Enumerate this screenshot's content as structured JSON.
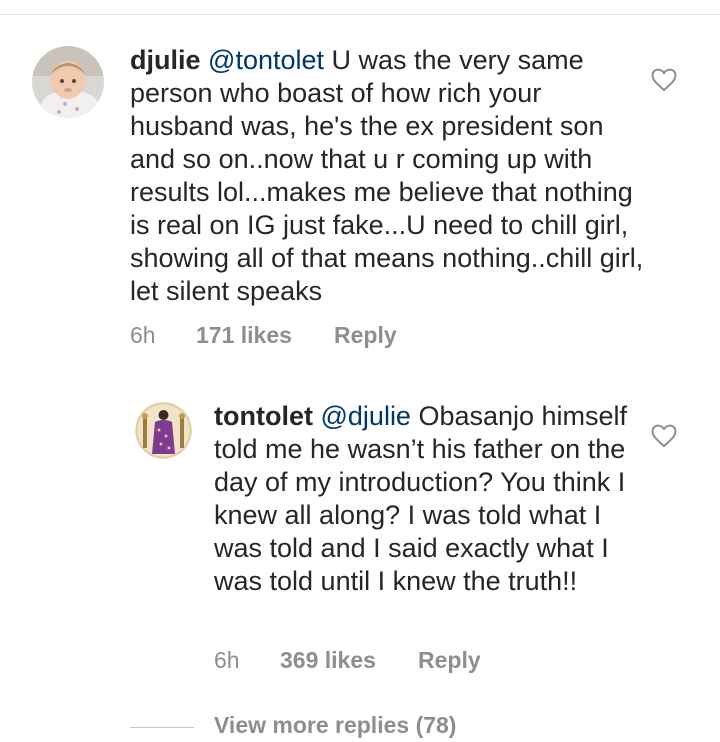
{
  "comments": [
    {
      "username": "djulie",
      "mention": "@tontolet",
      "body": " U was the very same person who boast of how rich your husband was, he's  the ex president son and so on..now that u r coming up with results lol...makes me believe that nothing is real on IG just fake...U need to chill girl, showing all of that means nothing..chill girl, let silent speaks",
      "time": "6h",
      "likes": "171 likes",
      "reply": "Reply",
      "like_icon": "heart-outline-icon"
    },
    {
      "username": "tontolet",
      "mention": "@djulie",
      "body": " Obasanjo himself told me he wasn’t his father on the day of my introduction? You think I knew all along? I was told what I was told and I said exactly what I was told until I knew the truth!!",
      "time": "6h",
      "likes": "369 likes",
      "reply": "Reply",
      "like_icon": "heart-outline-icon"
    }
  ],
  "view_more": "View more replies (78)"
}
